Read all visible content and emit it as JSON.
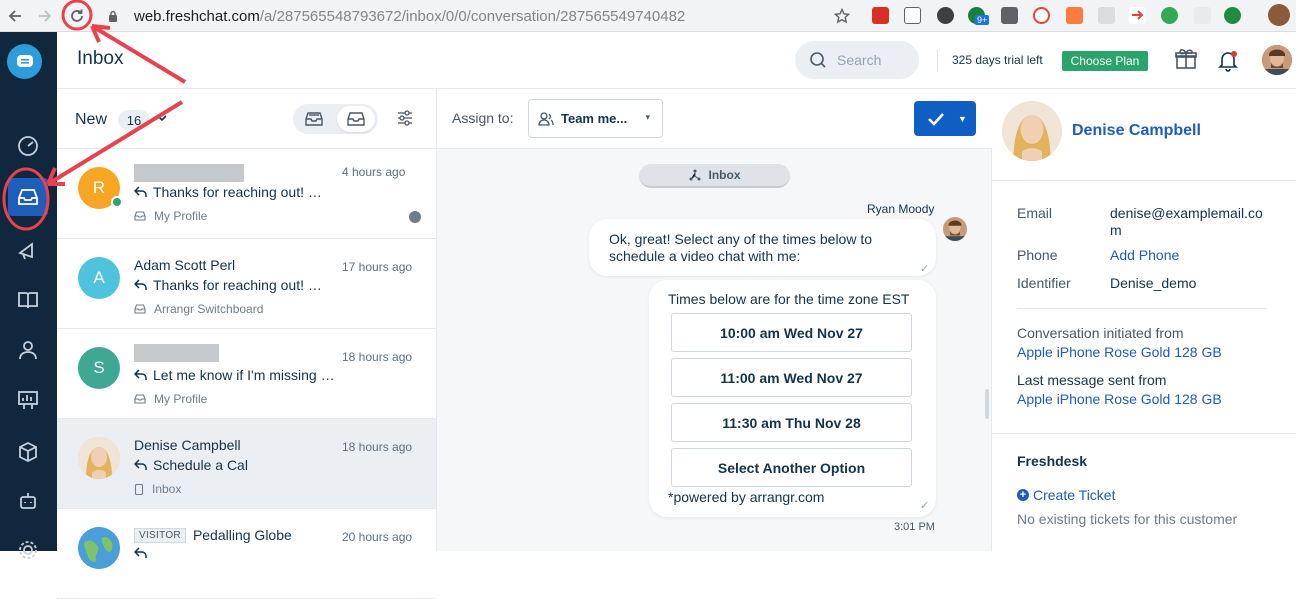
{
  "browser": {
    "url_domain": "web.freshchat.com",
    "url_path": "/a/287565548793672/inbox/0/0/conversation/287565549740482",
    "extension_badge": "9+"
  },
  "header": {
    "title": "Inbox",
    "search_placeholder": "Search",
    "trial_text": "325 days trial left",
    "choose_plan": "Choose Plan"
  },
  "list": {
    "filter_label": "New",
    "count": "16",
    "conversations": [
      {
        "name": "",
        "avatar_letter": "R",
        "avatar_color": "#f6a623",
        "time": "4 hours ago",
        "message": "Thanks for reaching out! …",
        "source": "My Profile"
      },
      {
        "name": "Adam Scott Perl",
        "avatar_letter": "A",
        "avatar_color": "#4fc3de",
        "time": "17 hours ago",
        "message": "Thanks for reaching out! …",
        "source": "Arrangr Switchboard"
      },
      {
        "name": "",
        "avatar_letter": "S",
        "avatar_color": "#3fa895",
        "time": "18 hours ago",
        "message": "Let me know if I'm missing …",
        "source": "My Profile"
      },
      {
        "name": "Denise Campbell",
        "avatar_letter": "",
        "avatar_color": "#e8c28a",
        "time": "18 hours ago",
        "message": "Schedule a Cal",
        "source": "Inbox"
      },
      {
        "name": "Pedalling Globe",
        "avatar_letter": "",
        "avatar_color": "#4a9fd8",
        "time": "20 hours ago",
        "message": "",
        "source": "",
        "badge": "VISITOR"
      }
    ]
  },
  "chat": {
    "assign_label": "Assign to:",
    "assign_value": "Team me...",
    "channel_pill": "Inbox",
    "agent_name": "Ryan Moody",
    "message1": "Ok, great! Select any of the times below to schedule a video chat with me:",
    "card_header": "Times below are for the time zone EST",
    "options": [
      "10:00 am Wed Nov 27",
      "11:00 am Wed Nov 27",
      "11:30 am Thu Nov 28",
      "Select Another Option"
    ],
    "powered_by": "*powered by arrangr.com",
    "time": "3:01 PM"
  },
  "contact": {
    "name": "Denise Campbell",
    "email_label": "Email",
    "email_line1": "denise@examplemail.co",
    "email_line2": "m",
    "phone_label": "Phone",
    "phone_value": "Add Phone",
    "identifier_label": "Identifier",
    "identifier_value": "Denise_demo",
    "initiated_label": "Conversation initiated from",
    "initiated_value": "Apple iPhone Rose Gold 128 GB",
    "last_label": "Last message sent from",
    "last_value": "Apple iPhone Rose Gold 128 GB",
    "freshdesk_title": "Freshdesk",
    "create_ticket": "Create Ticket",
    "no_tickets": "No existing tickets for this customer"
  },
  "colors": {
    "nav_bg": "#10273e",
    "primary_blue": "#0f5ec4",
    "plan_green": "#2ba46c",
    "annotation_red": "#e8424f"
  }
}
